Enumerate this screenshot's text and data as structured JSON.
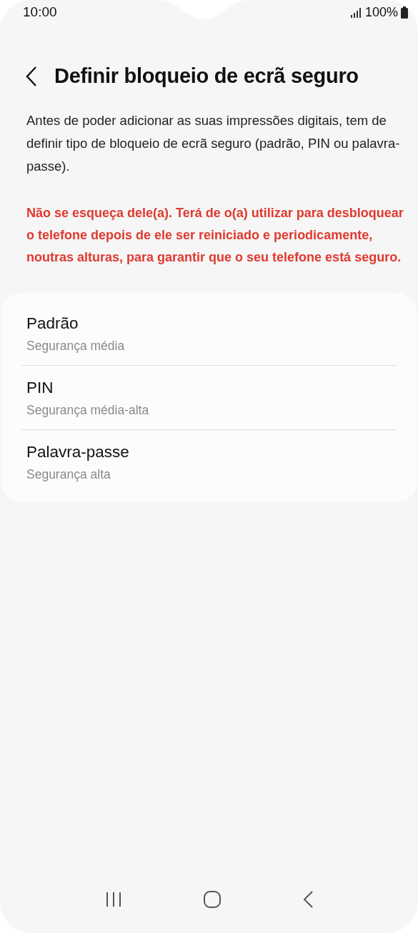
{
  "status_bar": {
    "time": "10:00",
    "battery": "100%"
  },
  "header": {
    "title": "Definir bloqueio de ecrã seguro"
  },
  "description": "Antes de poder adicionar as suas impressões digitais, tem de definir tipo de bloqueio de ecrã seguro (padrão, PIN ou palavra-passe).",
  "warning": "Não se esqueça dele(a). Terá de o(a) utilizar para desbloquear o telefone depois de ele ser reiniciado e periodicamente, noutras alturas, para garantir que o seu telefone está seguro.",
  "options": [
    {
      "title": "Padrão",
      "subtitle": "Segurança média"
    },
    {
      "title": "PIN",
      "subtitle": "Segurança média-alta"
    },
    {
      "title": "Palavra-passe",
      "subtitle": "Segurança alta"
    }
  ]
}
